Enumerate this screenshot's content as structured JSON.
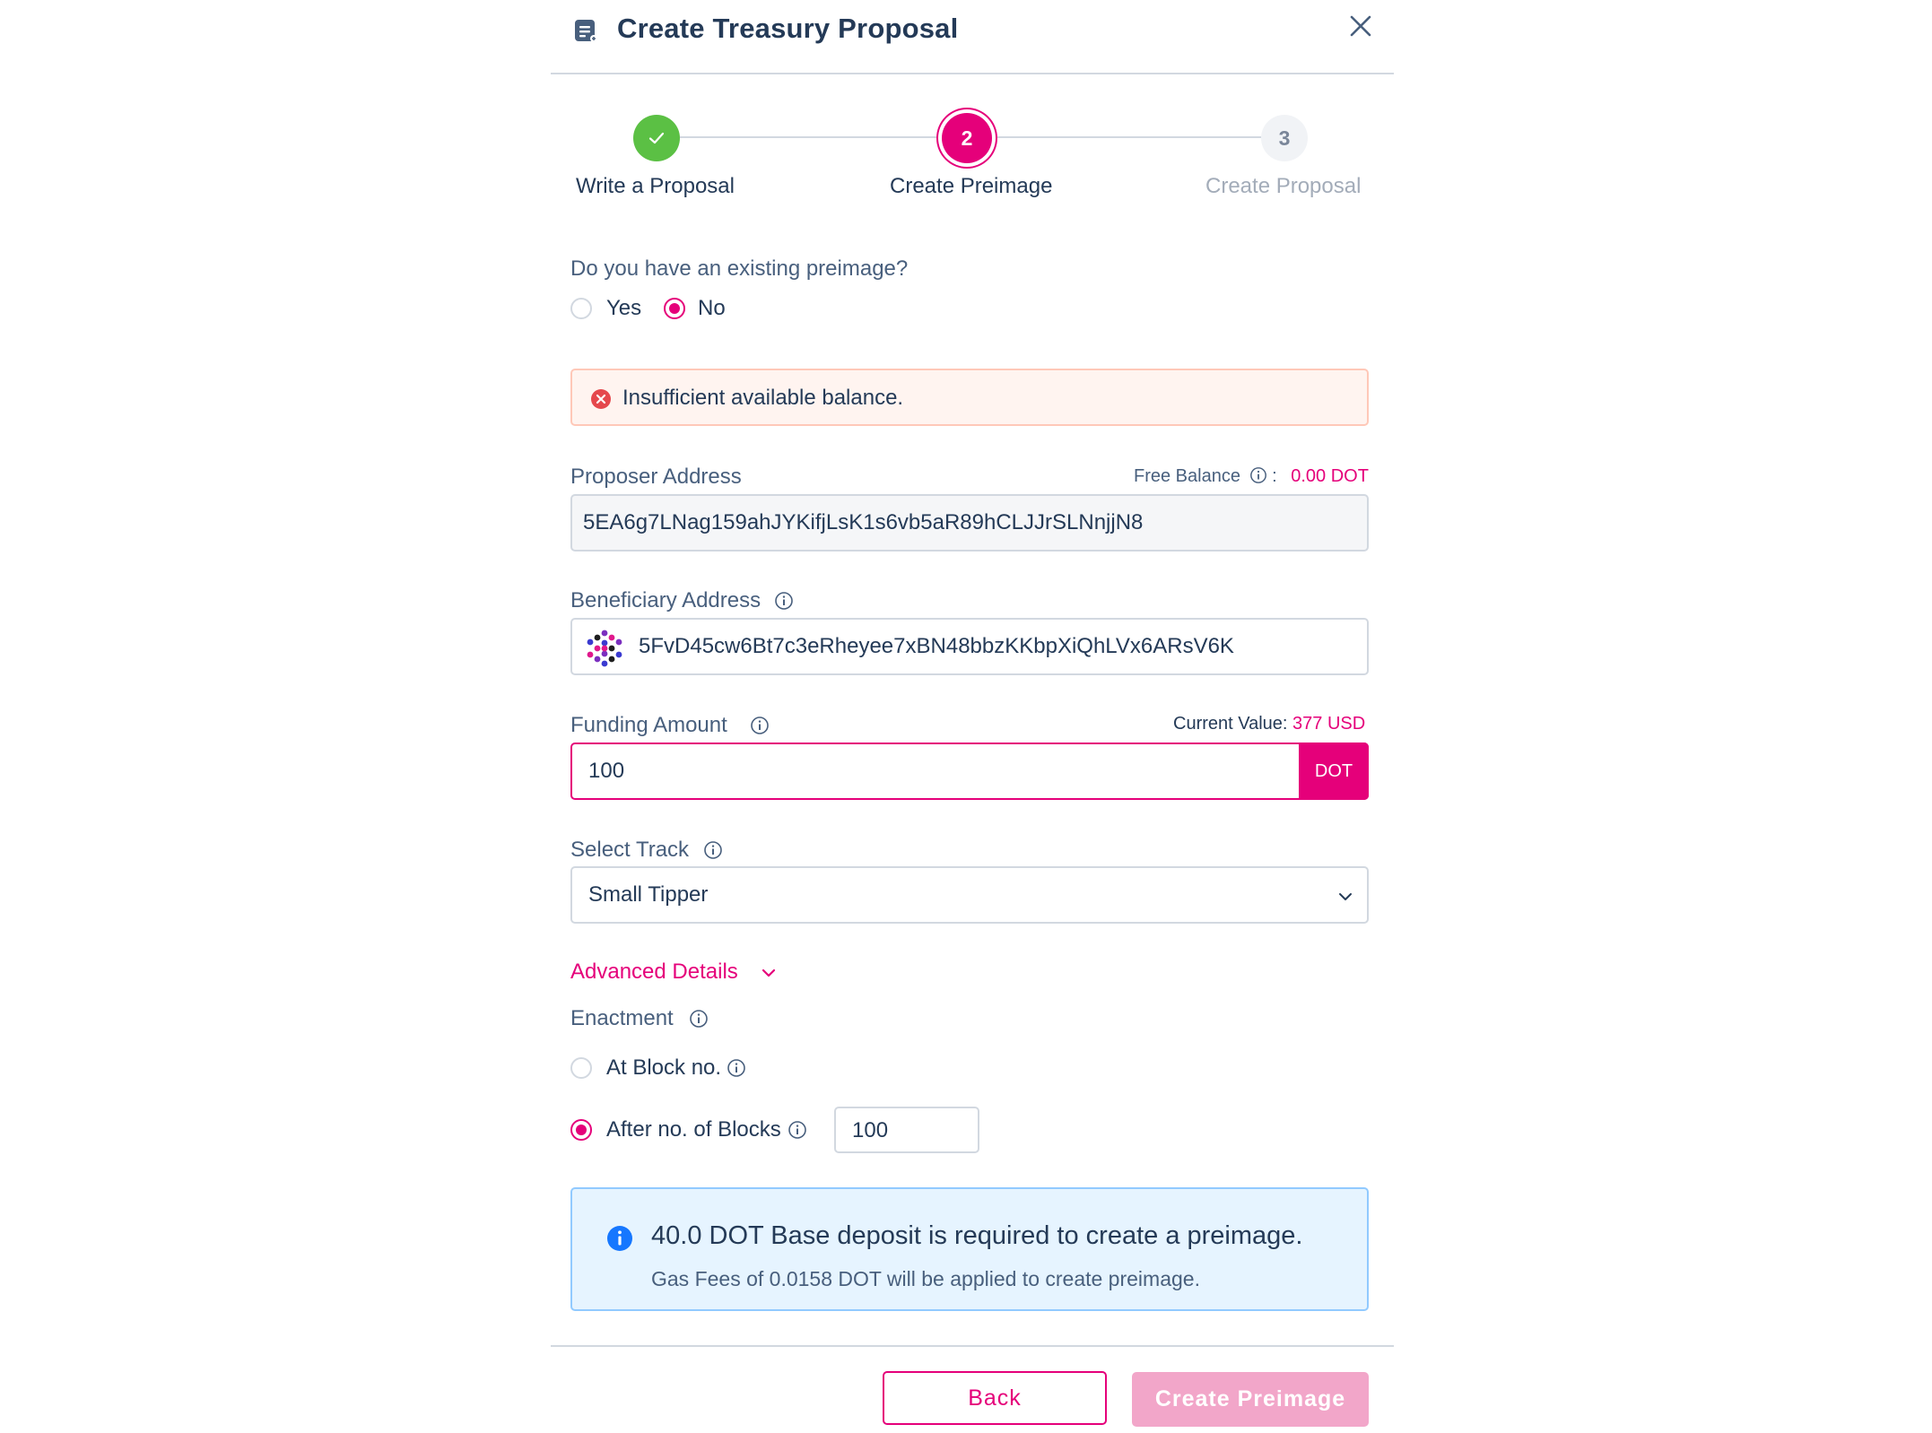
{
  "header": {
    "title": "Create Treasury Proposal"
  },
  "stepper": {
    "steps": [
      {
        "number": "",
        "label": "Write a Proposal",
        "state": "done"
      },
      {
        "number": "2",
        "label": "Create Preimage",
        "state": "active"
      },
      {
        "number": "3",
        "label": "Create Proposal",
        "state": "pending"
      }
    ]
  },
  "preimage": {
    "question": "Do you have an existing preimage?",
    "options": [
      "Yes",
      "No"
    ],
    "selected": "No"
  },
  "error_alert": {
    "message": "Insufficient available balance."
  },
  "proposer": {
    "label": "Proposer Address",
    "free_balance_label": "Free Balance",
    "free_balance_sep": ":",
    "free_balance_value": "0.00 DOT",
    "address": "5EA6g7LNag159ahJYKifjLsK1s6vb5aR89hCLJJrSLNnjjN8"
  },
  "beneficiary": {
    "label": "Beneficiary Address",
    "address": "5FvD45cw6Bt7c3eRheyee7xBN48bbzKKbpXiQhLVx6ARsV6K"
  },
  "funding": {
    "label": "Funding Amount",
    "current_value_label": "Current Value:",
    "current_value": "377 USD",
    "amount": "100",
    "unit": "DOT"
  },
  "track": {
    "label": "Select Track",
    "selected": "Small Tipper"
  },
  "advanced": {
    "link_label": "Advanced Details",
    "enactment_label": "Enactment",
    "options": [
      {
        "label": "At Block no.",
        "selected": false
      },
      {
        "label": "After no. of Blocks",
        "selected": true
      }
    ],
    "blocks_value": "100"
  },
  "info_alert": {
    "title": "40.0 DOT Base deposit is required to create a preimage.",
    "description": "Gas Fees of 0.0158 DOT will be applied to create preimage."
  },
  "footer": {
    "back_label": "Back",
    "create_label": "Create Preimage"
  },
  "colors": {
    "accent": "#E5007A",
    "success": "#5BC044",
    "text": "#243A57",
    "info_bg": "#E6F4FF",
    "error_bg": "#FFF4F0"
  }
}
